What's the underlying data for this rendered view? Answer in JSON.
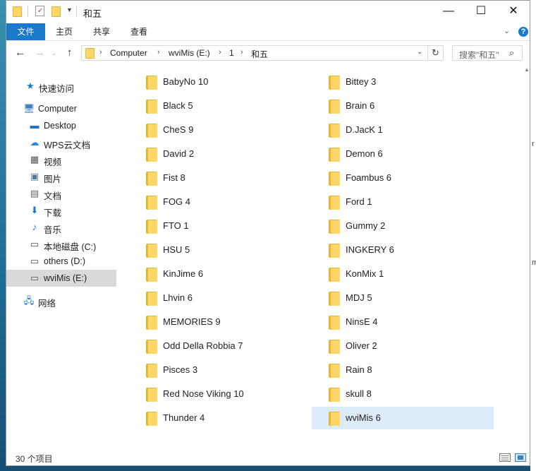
{
  "window": {
    "title": "和五",
    "controls": {
      "minimize": "—",
      "maximize": "☐",
      "close": "✕"
    }
  },
  "ribbon": {
    "tabs": [
      "文件",
      "主页",
      "共享",
      "查看"
    ],
    "help": "?"
  },
  "nav": {
    "back": "←",
    "forward": "→",
    "up": "↑",
    "breadcrumbs": [
      "Computer",
      "wviMis (E:)",
      "1",
      "和五"
    ],
    "refresh": "↻",
    "search_placeholder": "搜索\"和五\"",
    "search_icon": "⌕"
  },
  "sidebar": {
    "items": [
      {
        "label": "快速访问",
        "icon": "star-icon",
        "glyph": "★",
        "color": "#1979ca"
      },
      {
        "label": "Computer",
        "icon": "computer-icon",
        "glyph": "🖥",
        "color": "#3f7fbf"
      },
      {
        "label": "Desktop",
        "icon": "desktop-icon",
        "glyph": "▬",
        "color": "#1e73be"
      },
      {
        "label": "WPS云文档",
        "icon": "cloud-icon",
        "glyph": "☁",
        "color": "#2e86de"
      },
      {
        "label": "视频",
        "icon": "video-icon",
        "glyph": "▦",
        "color": "#555555"
      },
      {
        "label": "图片",
        "icon": "pictures-icon",
        "glyph": "▣",
        "color": "#557799"
      },
      {
        "label": "文档",
        "icon": "documents-icon",
        "glyph": "▤",
        "color": "#666666"
      },
      {
        "label": "下载",
        "icon": "download-icon",
        "glyph": "⬇",
        "color": "#1979ca"
      },
      {
        "label": "音乐",
        "icon": "music-icon",
        "glyph": "♪",
        "color": "#1979ca"
      },
      {
        "label": "本地磁盘 (C:)",
        "icon": "drive-c-icon",
        "glyph": "▭",
        "color": "#555555"
      },
      {
        "label": "others (D:)",
        "icon": "drive-d-icon",
        "glyph": "▭",
        "color": "#555555"
      },
      {
        "label": "wviMis (E:)",
        "icon": "drive-e-icon",
        "glyph": "▭",
        "color": "#555555"
      },
      {
        "label": "网络",
        "icon": "network-icon",
        "glyph": "🖧",
        "color": "#1979ca"
      }
    ],
    "selected": "wviMis (E:)"
  },
  "content": {
    "folders_left": [
      "BabyNo 10",
      "Black 5",
      "CheS 9",
      "David 2",
      "Fist 8",
      "FOG 4",
      "FTO 1",
      "HSU 5",
      "KinJime 6",
      "Lhvin 6",
      "MEMORIES 9",
      "Odd Della Robbia 7",
      "Pisces 3",
      "Red Nose Viking 10",
      "Thunder 4"
    ],
    "folders_right": [
      "Bittey 3",
      "Brain 6",
      "D.JacK 1",
      "Demon 6",
      "Foambus 6",
      "Ford 1",
      "Gummy 2",
      "INGKERY 6",
      "KonMix 1",
      "MDJ 5",
      "NinsE 4",
      "Oliver 2",
      "Rain 8",
      "skull 8",
      "wviMis 6"
    ],
    "selected": "wviMis 6"
  },
  "status": {
    "count": "30 个项目"
  },
  "background_text": {
    "line1": "r",
    "line2": "m"
  }
}
